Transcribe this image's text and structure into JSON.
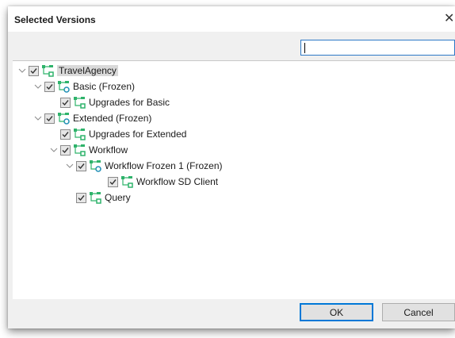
{
  "window": {
    "title": "Selected Versions",
    "close_glyph": "✕"
  },
  "search": {
    "value": "",
    "placeholder": ""
  },
  "tree": {
    "items": [
      {
        "label": "TravelAgency",
        "icon": "green-tree-icon",
        "expanded": true,
        "checked": true,
        "selected": true
      },
      {
        "label": "Basic (Frozen)",
        "icon": "frozen-version-icon",
        "expanded": true,
        "checked": true
      },
      {
        "label": "Upgrades for Basic",
        "icon": "green-tree-icon",
        "checked": true
      },
      {
        "label": "Extended (Frozen)",
        "icon": "frozen-version-icon",
        "expanded": true,
        "checked": true
      },
      {
        "label": "Upgrades for Extended",
        "icon": "green-tree-icon",
        "checked": true
      },
      {
        "label": "Workflow",
        "icon": "green-tree-icon",
        "expanded": true,
        "checked": true
      },
      {
        "label": "Workflow Frozen 1 (Frozen)",
        "icon": "frozen-version-icon",
        "expanded": true,
        "checked": true
      },
      {
        "label": "Workflow SD Client",
        "icon": "green-tree-icon",
        "checked": true
      },
      {
        "label": "Query",
        "icon": "green-tree-icon",
        "checked": true
      }
    ]
  },
  "buttons": {
    "ok": "OK",
    "cancel": "Cancel"
  },
  "colors": {
    "accent": "#0078d7",
    "tree_icon": "#2fb36b",
    "frozen_icon": "#1f8fb5"
  }
}
